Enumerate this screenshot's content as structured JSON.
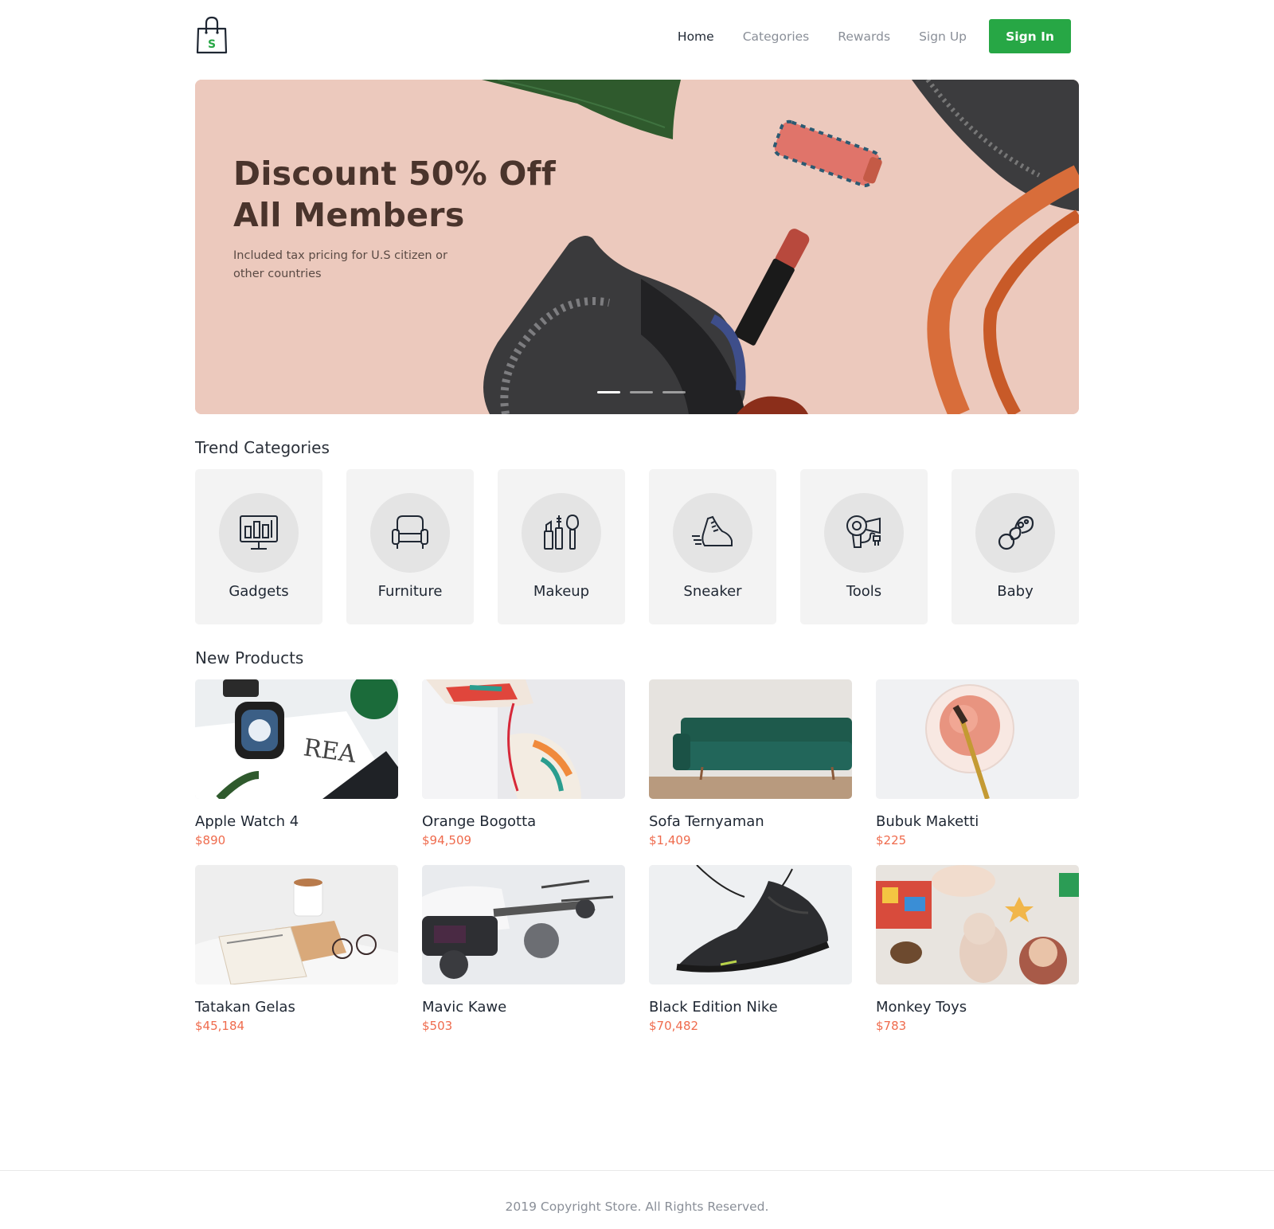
{
  "header": {
    "nav": [
      {
        "label": "Home",
        "active": true
      },
      {
        "label": "Categories",
        "active": false
      },
      {
        "label": "Rewards",
        "active": false
      },
      {
        "label": "Sign Up",
        "active": false
      }
    ],
    "signin_label": "Sign In",
    "logo_letter": "S"
  },
  "hero": {
    "title_line1": "Discount 50% Off",
    "title_line2": "All Members",
    "subtitle": "Included tax pricing for U.S citizen or other countries",
    "slides": 3,
    "active_slide": 1
  },
  "trend": {
    "title": "Trend Categories",
    "items": [
      {
        "label": "Gadgets",
        "icon": "gadgets-icon"
      },
      {
        "label": "Furniture",
        "icon": "armchair-icon"
      },
      {
        "label": "Makeup",
        "icon": "makeup-icon"
      },
      {
        "label": "Sneaker",
        "icon": "sneaker-icon"
      },
      {
        "label": "Tools",
        "icon": "hair-dryer-icon"
      },
      {
        "label": "Baby",
        "icon": "pacifier-icon"
      }
    ]
  },
  "new_products": {
    "title": "New Products",
    "items": [
      {
        "name": "Apple Watch 4",
        "price": "$890"
      },
      {
        "name": "Orange Bogotta",
        "price": "$94,509"
      },
      {
        "name": "Sofa Ternyaman",
        "price": "$1,409"
      },
      {
        "name": "Bubuk Maketti",
        "price": "$225"
      },
      {
        "name": "Tatakan Gelas",
        "price": "$45,184"
      },
      {
        "name": "Mavic Kawe",
        "price": "$503"
      },
      {
        "name": "Black Edition Nike",
        "price": "$70,482"
      },
      {
        "name": "Monkey Toys",
        "price": "$783"
      }
    ]
  },
  "footer": {
    "copyright": "2019 Copyright Store. All Rights Reserved."
  },
  "colors": {
    "accent": "#27a745",
    "price": "#ef6b4d",
    "hero_bg": "#ecc9bd"
  }
}
